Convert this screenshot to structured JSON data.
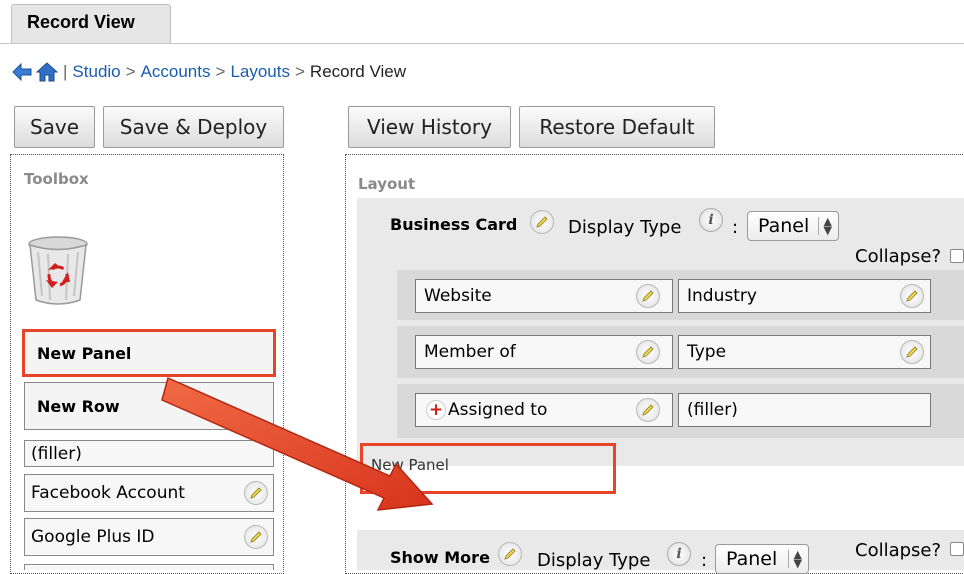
{
  "tab": {
    "label": "Record View"
  },
  "breadcrumb": {
    "separator_left": "|",
    "items": [
      "Studio",
      "Accounts",
      "Layouts"
    ],
    "arrow": ">",
    "current": "Record View"
  },
  "left_buttons": {
    "save": "Save",
    "save_deploy": "Save & Deploy"
  },
  "right_buttons": {
    "view_history": "View History",
    "restore_default": "Restore Default"
  },
  "toolbox": {
    "caption": "Toolbox",
    "new_panel": "New Panel",
    "new_row": "New Row",
    "filler": "(filler)",
    "fields": [
      "Facebook Account",
      "Google Plus ID"
    ]
  },
  "layout": {
    "caption": "Layout",
    "panel1": {
      "name": "Business Card",
      "display_type_label": "Display Type",
      "colon": ":",
      "display_type_value": "Panel",
      "collapse_label": "Collapse?",
      "rows": [
        [
          "Website",
          "Industry"
        ],
        [
          "Member of",
          "Type"
        ],
        [
          "Assigned to",
          "(filler)"
        ]
      ]
    },
    "new_panel_drop": "New Panel",
    "panel2": {
      "name": "Show More",
      "display_type_label": "Display Type",
      "colon": ":",
      "display_type_value": "Panel",
      "collapse_label": "Collapse?"
    }
  },
  "colors": {
    "highlight": "#e8442a",
    "link": "#1a5cb0",
    "arrow": "#e8442a"
  },
  "icons": [
    "back-arrow-icon",
    "home-icon",
    "trash-icon",
    "pencil-icon",
    "info-icon",
    "plus-icon",
    "select-arrows-icon"
  ]
}
